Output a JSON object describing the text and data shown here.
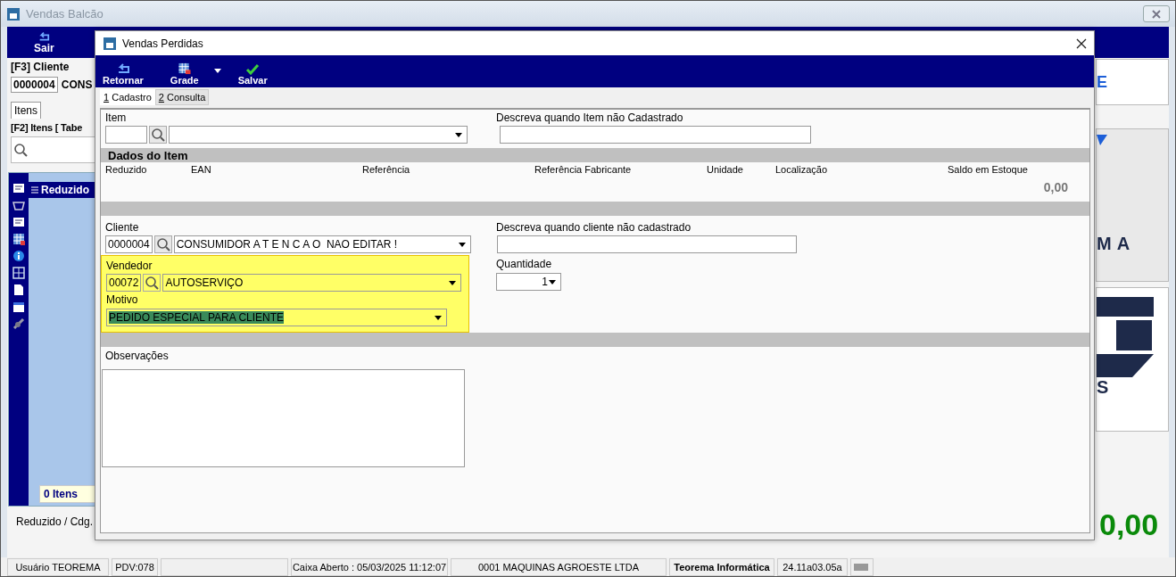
{
  "main_window": {
    "title": "Vendas Balcão",
    "toolbar": [
      {
        "label": "Sair"
      }
    ],
    "client_heading": "[F3] Cliente",
    "client_code": "0000004",
    "client_name": "CONS",
    "header_fragment": "E",
    "tabs": [
      {
        "label": "Itens",
        "selected": true
      }
    ],
    "items_heading": "[F2] Itens [ Tabe",
    "grid_column": "Reduzido",
    "item_count": "0 Itens",
    "search_hint": "Reduzido / Cdg.",
    "logo_texts": [
      "MA",
      "S"
    ],
    "total": "0,00"
  },
  "dialog": {
    "title": "Vendas Perdidas",
    "toolbar": [
      {
        "kind": "return",
        "label": "Retornar"
      },
      {
        "kind": "grid",
        "label": "Grade"
      },
      {
        "kind": "dropdown"
      },
      {
        "kind": "save",
        "label": "Salvar"
      }
    ],
    "tabs": [
      {
        "label": "1 Cadastro",
        "selected": true
      },
      {
        "label": "2 Consulta",
        "selected": false
      }
    ],
    "form": {
      "item_label": "Item",
      "item_free_label": "Descreva quando Item não Cadastrado",
      "section_title": "Dados do Item",
      "columns": [
        "Reduzido",
        "EAN",
        "Referência",
        "Referência Fabricante",
        "Unidade",
        "Localização",
        "Saldo em Estoque"
      ],
      "stock_value": "0,00",
      "cliente": {
        "label": "Cliente",
        "code": "0000004",
        "name": "CONSUMIDOR A T E N C A O  NAO EDITAR !"
      },
      "cliente_free_label": "Descreva quando cliente não cadastrado",
      "highlighted": true,
      "vendedor": {
        "label": "Vendedor",
        "code": "00072",
        "name": "AUTOSERVIÇO"
      },
      "motivo": {
        "label": "Motivo",
        "value": "PEDIDO ESPECIAL PARA CLIENTE",
        "text_selected": true
      },
      "quantidade": {
        "label": "Quantidade",
        "value": "1"
      },
      "observacoes_label": "Observações"
    }
  },
  "status_bar": [
    {
      "kind": "text",
      "text": "Usuário TEOREMA",
      "bold": false
    },
    {
      "kind": "text",
      "text": "PDV:078",
      "bold": false
    },
    {
      "kind": "empty"
    },
    {
      "kind": "text",
      "text": "Caixa Aberto : 05/03/2025 11:12:07",
      "bold": false
    },
    {
      "kind": "text",
      "text": "0001 MAQUINAS AGROESTE LTDA",
      "bold": false
    },
    {
      "kind": "text",
      "text": "Teorema Informática",
      "bold": true
    },
    {
      "kind": "text",
      "text": "24.11a03.05a",
      "bold": false
    },
    {
      "kind": "icon"
    }
  ]
}
